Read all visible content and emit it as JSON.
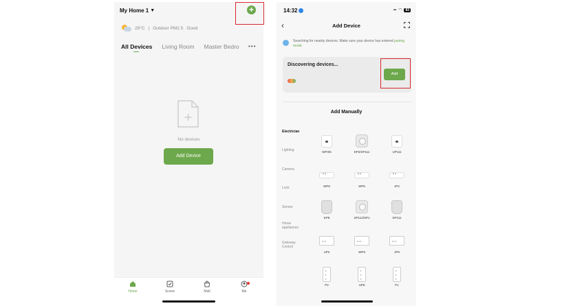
{
  "left": {
    "home_title": "My Home 1",
    "weather": {
      "temp": "29°C",
      "divider": "|",
      "air": "Outdoor PM2.5",
      "air_status": "Good"
    },
    "tabs": [
      "All Devices",
      "Living Room",
      "Master Bedro"
    ],
    "more": "•••",
    "empty_text": "No devices",
    "add_device_button": "Add Device",
    "tabbar": [
      "Home",
      "Scene",
      "Mall",
      "Me"
    ],
    "accent": "#6da84c"
  },
  "right": {
    "status_time": "14:32",
    "battery": "83",
    "nav_title": "Add Device",
    "searching_text": "Searching for nearby devices. Make sure your device has entered",
    "pairing_link": "pairing mode.",
    "discovering": "Discovering devices...",
    "add_button": "Add",
    "add_manually": "Add Manually",
    "categories": [
      "Electrician",
      "Lighting",
      "Camera",
      "Lock",
      "Sensor",
      "Home appliances",
      "Gateway Control"
    ],
    "devices": [
      "WP3/5",
      "EP2/SP111",
      "UP111",
      "WP6",
      "WP6",
      "JP2",
      "EP8",
      "SP112/SP1",
      "SP211",
      "UP2",
      "WP9",
      "JP9",
      "P2",
      "UP9",
      "P1"
    ]
  }
}
